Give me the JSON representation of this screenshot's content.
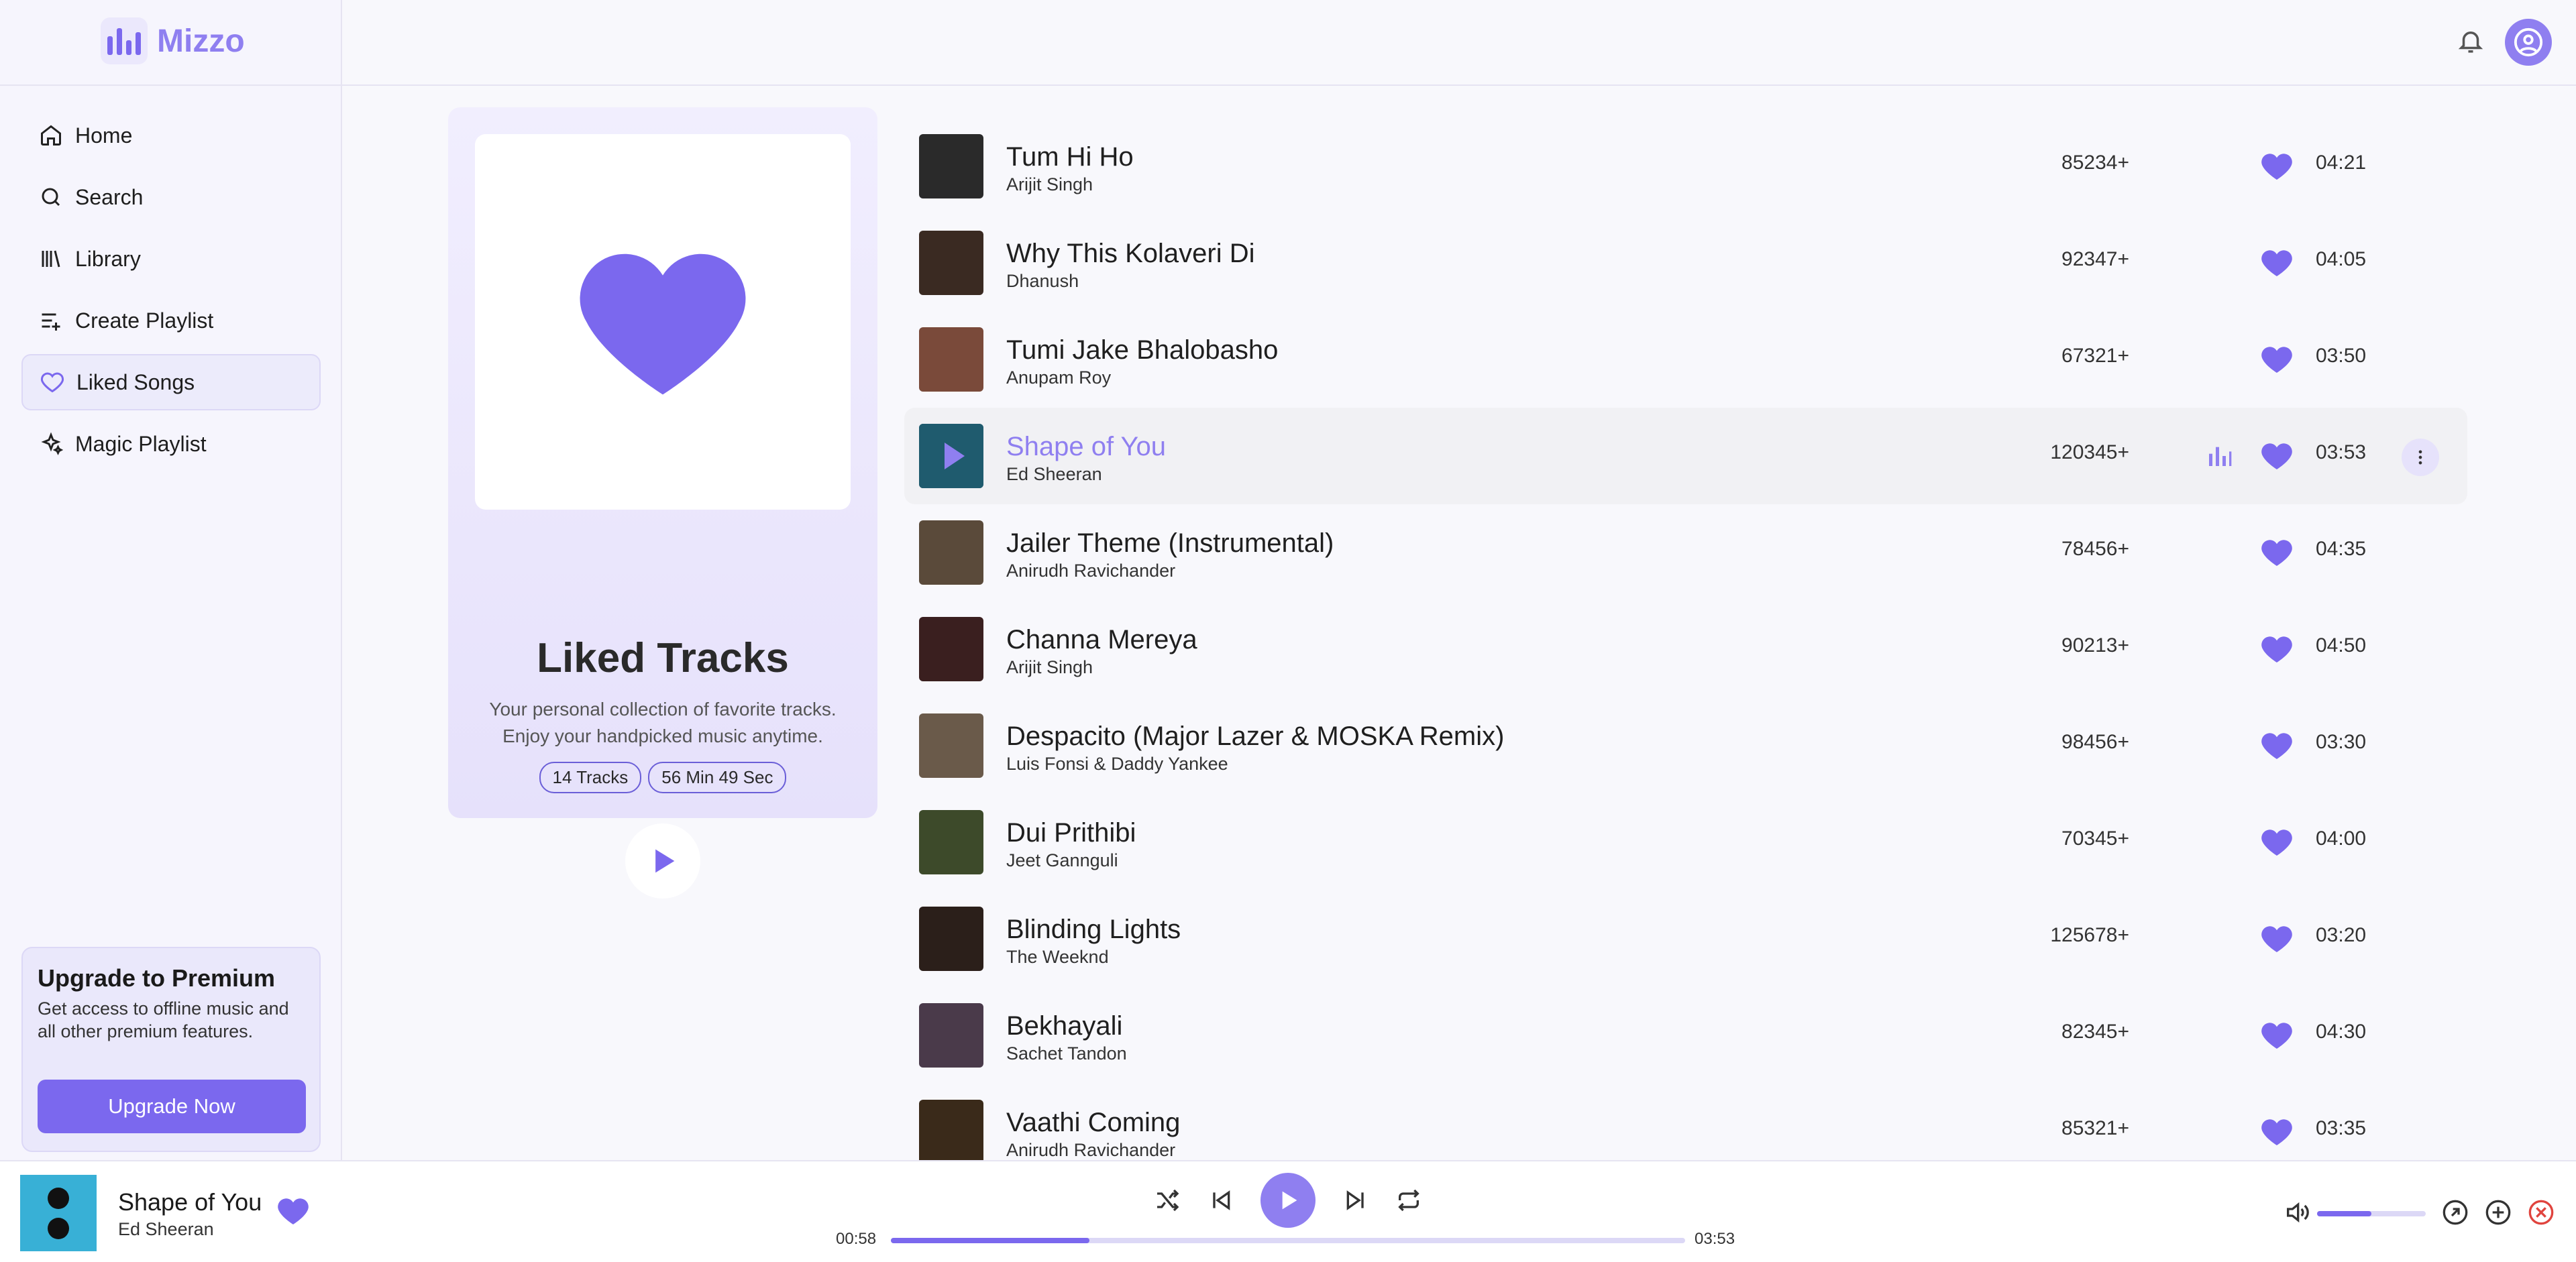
{
  "app": {
    "name": "Mizzo",
    "colors": {
      "accent": "#7b68ee",
      "accent_light": "#8f7ff0",
      "background": "#f8f8fc"
    }
  },
  "sidebar": {
    "items": [
      {
        "label": "Home",
        "icon": "home-icon"
      },
      {
        "label": "Search",
        "icon": "search-icon"
      },
      {
        "label": "Library",
        "icon": "library-icon"
      },
      {
        "label": "Create Playlist",
        "icon": "playlist-add-icon"
      },
      {
        "label": "Liked Songs",
        "icon": "heart-icon",
        "active": true
      },
      {
        "label": "Magic Playlist",
        "icon": "sparkles-icon"
      }
    ],
    "premium": {
      "title": "Upgrade to Premium",
      "description": "Get access to offline music and all other premium features.",
      "button": "Upgrade Now"
    }
  },
  "header": {
    "bell_icon": "bell-icon",
    "avatar_icon": "user-icon"
  },
  "liked": {
    "title": "Liked Tracks",
    "description_line1": "Your personal collection of favorite tracks.",
    "description_line2": "Enjoy your handpicked music anytime.",
    "tracks_pill": "14 Tracks",
    "duration_pill": "56 Min 49 Sec"
  },
  "tracks": [
    {
      "title": "Tum Hi Ho",
      "artist": "Arijit Singh",
      "plays": "85234+",
      "duration": "04:21"
    },
    {
      "title": "Why This Kolaveri Di",
      "artist": "Dhanush",
      "plays": "92347+",
      "duration": "04:05"
    },
    {
      "title": "Tumi Jake Bhalobasho",
      "artist": "Anupam Roy",
      "plays": "67321+",
      "duration": "03:50"
    },
    {
      "title": "Shape of You",
      "artist": "Ed Sheeran",
      "plays": "120345+",
      "duration": "03:53",
      "active": true
    },
    {
      "title": "Jailer Theme (Instrumental)",
      "artist": "Anirudh Ravichander",
      "plays": "78456+",
      "duration": "04:35"
    },
    {
      "title": "Channa Mereya",
      "artist": "Arijit Singh",
      "plays": "90213+",
      "duration": "04:50"
    },
    {
      "title": "Despacito (Major Lazer & MOSKA Remix)",
      "artist": "Luis Fonsi & Daddy Yankee",
      "plays": "98456+",
      "duration": "03:30"
    },
    {
      "title": "Dui Prithibi",
      "artist": "Jeet Gannguli",
      "plays": "70345+",
      "duration": "04:00"
    },
    {
      "title": "Blinding Lights",
      "artist": "The Weeknd",
      "plays": "125678+",
      "duration": "03:20"
    },
    {
      "title": "Bekhayali",
      "artist": "Sachet Tandon",
      "plays": "82345+",
      "duration": "04:30"
    },
    {
      "title": "Vaathi Coming",
      "artist": "Anirudh Ravichander",
      "plays": "85321+",
      "duration": "03:35"
    }
  ],
  "player": {
    "title": "Shape of You",
    "artist": "Ed Sheeran",
    "current_time": "00:58",
    "total_time": "03:53",
    "progress": 0.25,
    "volume": 0.5
  }
}
